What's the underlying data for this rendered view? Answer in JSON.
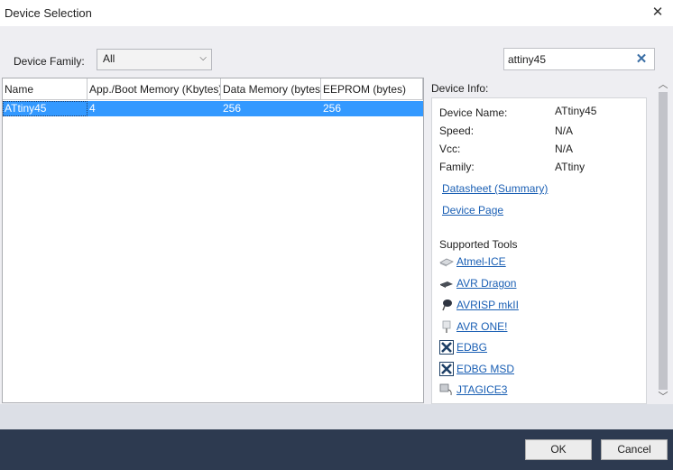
{
  "window": {
    "title": "Device Selection"
  },
  "filter": {
    "family_label": "Device Family:",
    "family_value": "All"
  },
  "search": {
    "value": "attiny45"
  },
  "table": {
    "columns": [
      "Name",
      "App./Boot Memory (Kbytes)",
      "Data Memory (bytes)",
      "EEPROM (bytes)"
    ],
    "rows": [
      {
        "name": "ATtiny45",
        "app_memory": "4",
        "data_memory": "256",
        "eeprom": "256"
      }
    ]
  },
  "info": {
    "label": "Device Info:",
    "fields": [
      {
        "key": "Device Name:",
        "value": "ATtiny45"
      },
      {
        "key": "Speed:",
        "value": "N/A"
      },
      {
        "key": "Vcc:",
        "value": "N/A"
      },
      {
        "key": "Family:",
        "value": "ATtiny"
      }
    ],
    "links": [
      "Datasheet (Summary)",
      "Device Page"
    ],
    "tools_heading": "Supported Tools",
    "tools": [
      {
        "name": "Atmel-ICE",
        "icon": "atmel-ice-icon"
      },
      {
        "name": "AVR Dragon",
        "icon": "avr-dragon-icon"
      },
      {
        "name": "AVRISP mkII",
        "icon": "avrisp-icon"
      },
      {
        "name": "AVR ONE!",
        "icon": "avr-one-icon"
      },
      {
        "name": "EDBG",
        "icon": "edbg-icon"
      },
      {
        "name": "EDBG MSD",
        "icon": "edbg-msd-icon"
      },
      {
        "name": "JTAGICE3",
        "icon": "jtagice3-icon"
      }
    ]
  },
  "footer": {
    "ok_label": "OK",
    "cancel_label": "Cancel"
  },
  "colors": {
    "selection": "#3399ff",
    "link": "#1a5fb4",
    "footer_bg": "#2d3a50"
  }
}
